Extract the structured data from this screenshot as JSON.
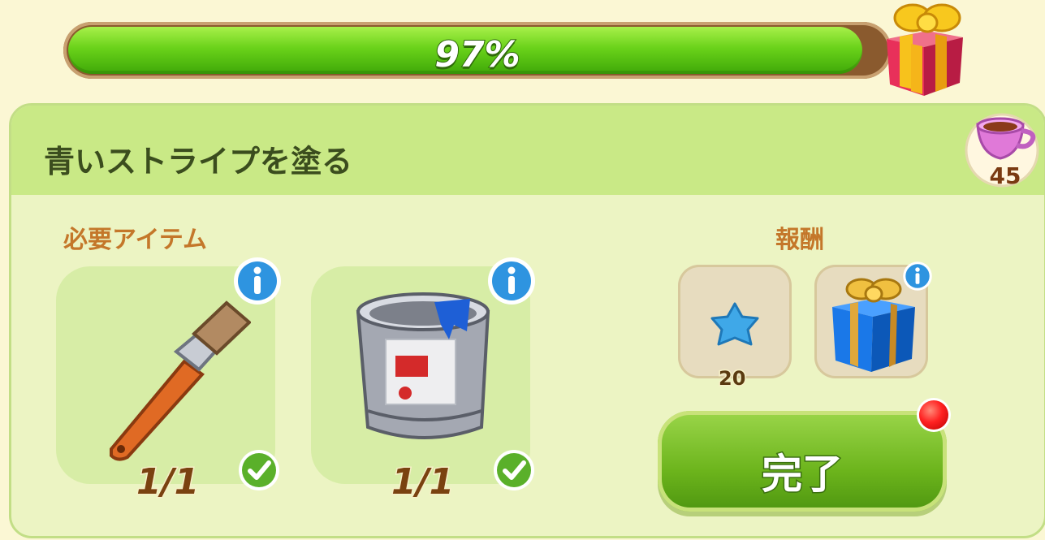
{
  "progress": {
    "label": "97%",
    "fraction": 0.97
  },
  "task": {
    "title": "青いストライプを塗る"
  },
  "cup_badge": {
    "count": "45",
    "icon": "teacup-icon"
  },
  "required": {
    "label": "必要アイテム",
    "items": [
      {
        "icon": "paintbrush-icon",
        "count": "1/1"
      },
      {
        "icon": "paint-can-icon",
        "count": "1/1"
      }
    ]
  },
  "rewards": {
    "label": "報酬",
    "items": [
      {
        "icon": "blue-star-icon",
        "value": "20"
      },
      {
        "icon": "blue-gift-icon"
      }
    ]
  },
  "done_button": {
    "label": "完了"
  },
  "colors": {
    "accent_green": "#6cb41c",
    "header_green": "#c9e986",
    "label_orange": "#c4772a"
  }
}
